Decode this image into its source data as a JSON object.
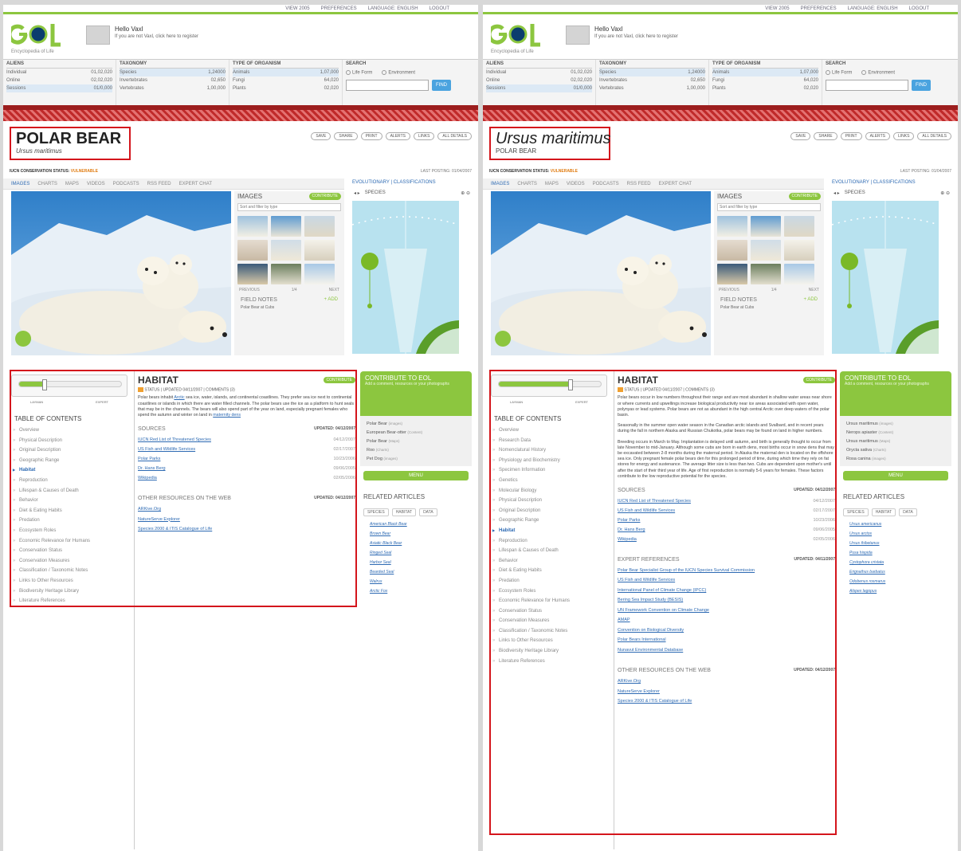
{
  "top_nav": [
    "VIEW 2005",
    "PREFERENCES",
    "LANGUAGE: ENGLISH",
    "LOGOUT"
  ],
  "header": {
    "logo_text": "eol",
    "tagline": "Encyclopedia of Life",
    "greeting": "Hello Vaxl",
    "greeting_sub": "If you are not Vaxl, click here to register"
  },
  "stats": {
    "blocks": [
      {
        "title": "ALIENS",
        "rows": [
          [
            "Individual",
            "01,02,020"
          ],
          [
            "Online",
            "02,02,020"
          ],
          [
            "Sessions",
            "01/0,000"
          ]
        ]
      },
      {
        "title": "TAXONOMY",
        "rows": [
          [
            "Species",
            "1,24000"
          ],
          [
            "Invertebrates",
            "02,650"
          ],
          [
            "Vertebrates",
            "1,00,000"
          ]
        ]
      },
      {
        "title": "TYPE OF ORGANISM",
        "rows": [
          [
            "Animals",
            "1,07,000"
          ],
          [
            "Fungi",
            "64,020"
          ],
          [
            "Plants",
            "02,020"
          ]
        ]
      }
    ],
    "search_title": "SEARCH",
    "radio1": "Life Form",
    "radio2": "Environment",
    "find": "FIND"
  },
  "actions": [
    "SAVE",
    "SHARE",
    "PRINT",
    "ALERTS",
    "LINKS",
    "ALL DETAILS"
  ],
  "iucn_label": "IUCN CONSERVATION STATUS:",
  "iucn_value": "VULNERABLE",
  "last_posting": "LAST POSTING: 01/04/2007",
  "tabs": [
    "IMAGES",
    "CHARTS",
    "MAPS",
    "VIDEOS",
    "PODCASTS",
    "RSS FEED",
    "EXPERT CHAT"
  ],
  "images_panel": {
    "title": "IMAGES",
    "badge": "CONTRIBUTE",
    "select": "Sort and filter by type",
    "prev": "PREVIOUS",
    "page": "1/4",
    "next": "NEXT",
    "field_notes": "FIELD NOTES",
    "add": "+ ADD",
    "field_sub": "Polar Bear at Cubs"
  },
  "sidepanel": {
    "header": "EVOLUTIONARY  |  CLASSIFICATIONS",
    "tool": "SPECIES"
  },
  "toc_title": "TABLE OF CONTENTS",
  "slider_labels": [
    "LAYMAN",
    "EXPERT"
  ],
  "section_title": "HABITAT",
  "section_badge": "CONTRIBUTE",
  "meta": "STATUS  |  UPDATED 04/11/2007  |  COMMENTS (3)",
  "left_toc": [
    "Overview",
    "Physical Description",
    "Original Description",
    "Geographic Range",
    "Habitat",
    "Reproduction",
    "Lifespan & Causes of Death",
    "Behavior",
    "Diet & Eating Habits",
    "Predation",
    "Ecosystem Roles",
    "Economic Relevance for Humans",
    "Conservation Status",
    "Conservation Measures",
    "Classification / Taxonomic Notes",
    "Links to Other Resources",
    "Biodiversity Heritage Library",
    "Literature References"
  ],
  "right_toc": [
    "Overview",
    "Research Data",
    "Nomenclatural History",
    "Physiology and Biochemistry",
    "Specimen Information",
    "Genetics",
    "Molecular Biology",
    "Physical Description",
    "Original Description",
    "Geographic Range",
    "Habitat",
    "Reproduction",
    "Lifespan & Causes of Death",
    "Behavior",
    "Diet & Eating Habits",
    "Predation",
    "Ecosystem Roles",
    "Economic Relevance for Humans",
    "Conservation Status",
    "Conservation Measures",
    "Classification / Taxonomic Notes",
    "Links to Other Resources",
    "Biodiversity Heritage Library",
    "Literature References"
  ],
  "left": {
    "title": "POLAR BEAR",
    "subtitle": "Ursus maritimus",
    "habitat_text_a": "Polar bears inhabit ",
    "habitat_link_a": "Arctic",
    "habitat_text_b": " sea ice, water, islands, and continental coastlines. They prefer sea ice next to continental coastlines or islands in which there are water filled channels. The polar bears use the ice as a platform to hunt seals that may be in the channels. The bears will also spend part of the year on land, especially pregnant females who spend the autumn and winter on land in ",
    "habitat_link_b": "maternity dens",
    "sources_title": "SOURCES",
    "sources_updated": "UPDATED: 04/12/2007",
    "sources": [
      {
        "name": "IUCN Red List of Threatened Species",
        "date": "04/12/2007"
      },
      {
        "name": "US Fish and Wildlife Services",
        "date": "02/17/2007"
      },
      {
        "name": "Polar Parks",
        "date": "10/23/2006"
      },
      {
        "name": "Dr. Hans Berg",
        "date": "09/06/2005"
      },
      {
        "name": "Wikipedia",
        "date": "02/05/2006"
      }
    ],
    "other_title": "OTHER RESOURCES ON THE WEB",
    "other_updated": "UPDATED: 04/12/2007",
    "other": [
      "ARKive.Org",
      "NatureServe Explorer",
      "Species 2000 & ITIS Catalogue of Life"
    ],
    "contrib_title": "CONTRIBUTE TO EOL",
    "contrib_sub": "Add a comment, resources or your photographs",
    "contrib_list": [
      [
        "Polar Bear",
        "(images)"
      ],
      [
        "European Bear-otter",
        "(Content)"
      ],
      [
        "Polar Bear",
        "(Maps)"
      ],
      [
        "Roo",
        "(Charts)"
      ],
      [
        "Pet Dog",
        "(images)"
      ]
    ],
    "menu": "MENU",
    "related_title": "RELATED ARTICLES",
    "rel_tabs": [
      "SPECIES",
      "HABITAT",
      "DATA"
    ],
    "related": [
      "American Black Bear",
      "Brown Bear",
      "Asiatic Black Bear",
      "Ringed Seal",
      "Harbor Seal",
      "Bearded Seal",
      "Walrus",
      "Arctic Fox"
    ]
  },
  "right": {
    "title": "Ursus maritimus",
    "subtitle": "POLAR BEAR",
    "p1": "Polar bears occur in low numbers throughout their range and are most abundant in shallow water areas near shore or where currents and upwellings increase biological productivity near ice areas associated with open water, polynyas or lead systems. Polar bears are not as abundant in the high central Arctic over deep waters of the polar basin.",
    "p2": "Seasonally in the summer open water season in the Canadian arctic islands and Svalbard, and in recent years during the fall in northern Alaska and Russian Chukotka, polar bears may be found on land in higher numbers.",
    "p3": "Breeding occurs in March to May. Implantation is delayed until autumn, and birth is generally thought to occur from late November to mid-January. Although some cubs are born in earth dens, most births occur in snow dens that may be excavated between 2-8 months during the maternal period. In Alaska the maternal den is located on the offshore sea ice. Only pregnant female polar bears den for this prolonged period of time, during which time they rely on fat stores for energy and sustenance. The average litter size is less than two. Cubs are dependent upon mother's until after the start of their third year of life. Age of first reproduction is normally 5-6 years for females. These factors contribute to the low reproductive potential for the species.",
    "sources_title": "SOURCES",
    "sources_updated": "UPDATED: 04/12/2007",
    "sources": [
      {
        "name": "IUCN Red List of Threatened Species",
        "date": "04/12/2007"
      },
      {
        "name": "US Fish and Wildlife Services",
        "date": "02/17/2007"
      },
      {
        "name": "Polar Parks",
        "date": "10/23/2006"
      },
      {
        "name": "Dr. Hans Berg",
        "date": "09/06/2005"
      },
      {
        "name": "Wikipedia",
        "date": "02/05/2006"
      }
    ],
    "expert_title": "EXPERT REFERENCES",
    "expert_updated": "UPDATED: 04/11/2007",
    "expert": [
      "Polar Bear Specialist Group of the IUCN Species Survival Commission",
      "US Fish and Wildlife Services",
      "International Panel of Climate Change (IPCC)",
      "Bering Sea Impact Study (BESIS)",
      "UN Framework Convention on Climate Change",
      "AMAP",
      "Convention on Biological Diversity",
      "Polar Bears International",
      "Nunavut Environmental Database"
    ],
    "other_title": "OTHER RESOURCES ON THE WEB",
    "other_updated": "UPDATED: 04/12/2007",
    "other": [
      "ARKive.Org",
      "NatureServe Explorer",
      "Species 2000 & ITIS Catalogue of Life"
    ],
    "contrib_title": "CONTRIBUTE TO EOL",
    "contrib_sub": "Add a comment, resources or your photographs",
    "contrib_list": [
      [
        "Ursus maritimus",
        "(images)"
      ],
      [
        "Nerops apiaster",
        "(Content)"
      ],
      [
        "Ursus maritimus",
        "(Maps)"
      ],
      [
        "Orycta sativa",
        "(Charts)"
      ],
      [
        "Rosa canina",
        "(images)"
      ]
    ],
    "menu": "MENU",
    "related_title": "RELATED ARTICLES",
    "rel_tabs": [
      "SPECIES",
      "HABITAT",
      "DATA"
    ],
    "related": [
      "Ursus americanus",
      "Ursus arctos",
      "Ursus thibetanus",
      "Pusa hispida",
      "Cystophora cristata",
      "Erignathus barbatus",
      "Odobenus rosmarus",
      "Alopex lagopus"
    ]
  },
  "slider_level": {
    "left": 0.25,
    "right": 0.7
  }
}
